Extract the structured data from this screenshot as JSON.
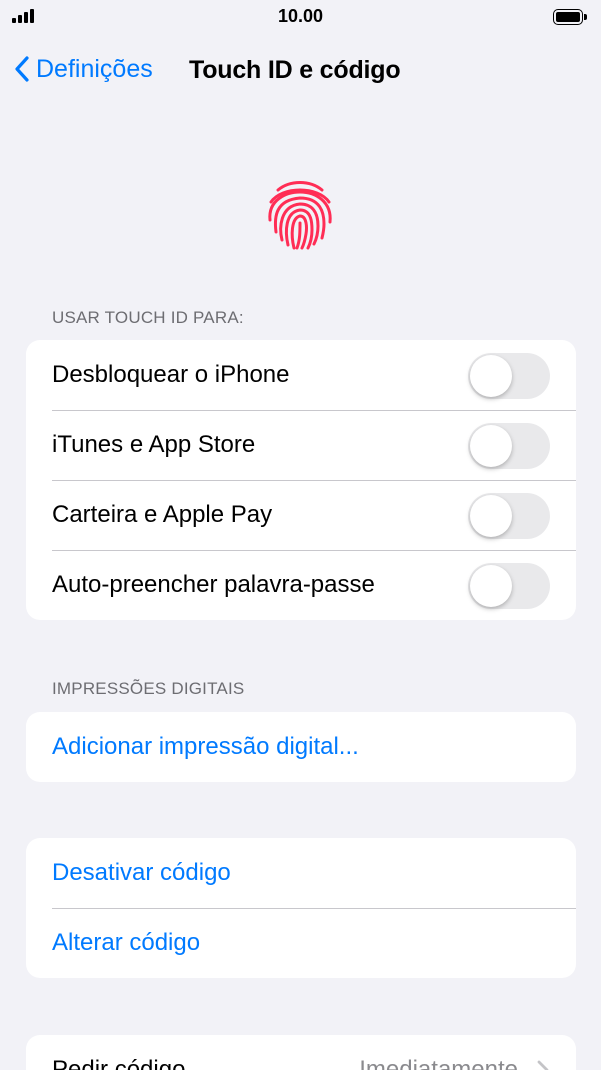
{
  "status_bar": {
    "time": "10.00"
  },
  "nav": {
    "back_label": "Definições",
    "title": "Touch ID e código"
  },
  "touch_id": {
    "header": "USAR TOUCH ID PARA:",
    "items": [
      {
        "label": "Desbloquear o iPhone",
        "enabled": false
      },
      {
        "label": "iTunes e App Store",
        "enabled": false
      },
      {
        "label": "Carteira e Apple Pay",
        "enabled": false
      },
      {
        "label": "Auto-preencher palavra-passe",
        "enabled": false
      }
    ]
  },
  "fingerprints": {
    "header": "IMPRESSÕES DIGITAIS",
    "add_label": "Adicionar impressão digital..."
  },
  "passcode": {
    "disable_label": "Desativar código",
    "change_label": "Alterar código"
  },
  "require_passcode": {
    "label": "Pedir código",
    "value": "Imediatamente"
  },
  "colors": {
    "accent": "#007aff",
    "fingerprint": "#ff2d55",
    "background": "#f2f2f7"
  },
  "icons": [
    "signal-icon",
    "battery-icon",
    "chevron-left-icon",
    "fingerprint-icon",
    "chevron-right-icon"
  ]
}
